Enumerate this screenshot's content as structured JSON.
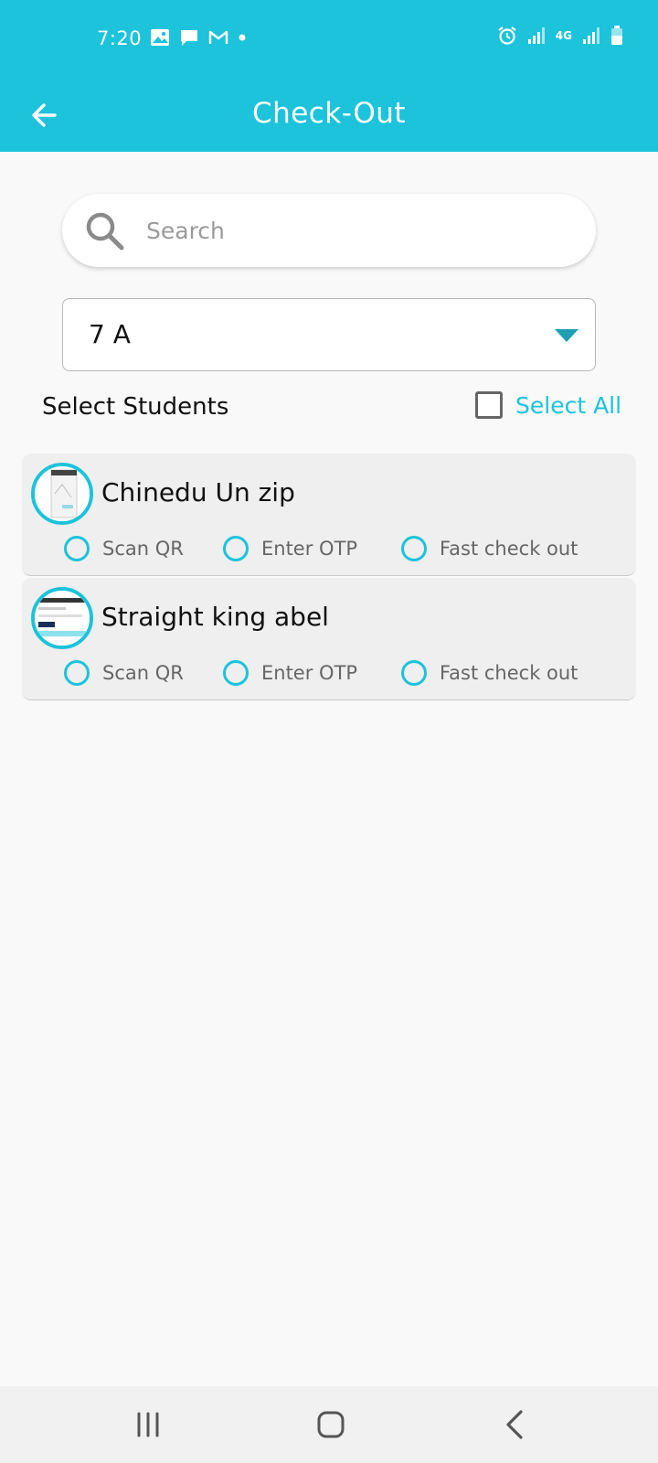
{
  "status_bar": {
    "time": "7:20",
    "left_icons": [
      "image-icon",
      "chat-icon",
      "gmail-icon",
      "dot-icon"
    ],
    "right_icons": [
      "alarm-icon",
      "signal-icon",
      "4g-icon",
      "signal-icon",
      "battery-icon"
    ],
    "network_label": "4G"
  },
  "app_bar": {
    "title": "Check-Out",
    "back_icon": "arrow-left-icon"
  },
  "search": {
    "placeholder": "Search",
    "value": ""
  },
  "class_select": {
    "selected": "7 A"
  },
  "section": {
    "title": "Select Students",
    "select_all_label": "Select All",
    "select_all_checked": false
  },
  "students": [
    {
      "name": "Chinedu Un zip",
      "options": [
        "Scan QR",
        "Enter OTP",
        "Fast check out"
      ]
    },
    {
      "name": "Straight king abel",
      "options": [
        "Scan QR",
        "Enter OTP",
        "Fast check out"
      ]
    }
  ],
  "nav_bar": {
    "buttons": [
      "recent-apps-icon",
      "home-icon",
      "back-icon"
    ]
  },
  "colors": {
    "primary": "#1cc3da",
    "background": "#f9f9f9",
    "card": "#efefef",
    "dropdown_arrow": "#1e9fb3"
  }
}
